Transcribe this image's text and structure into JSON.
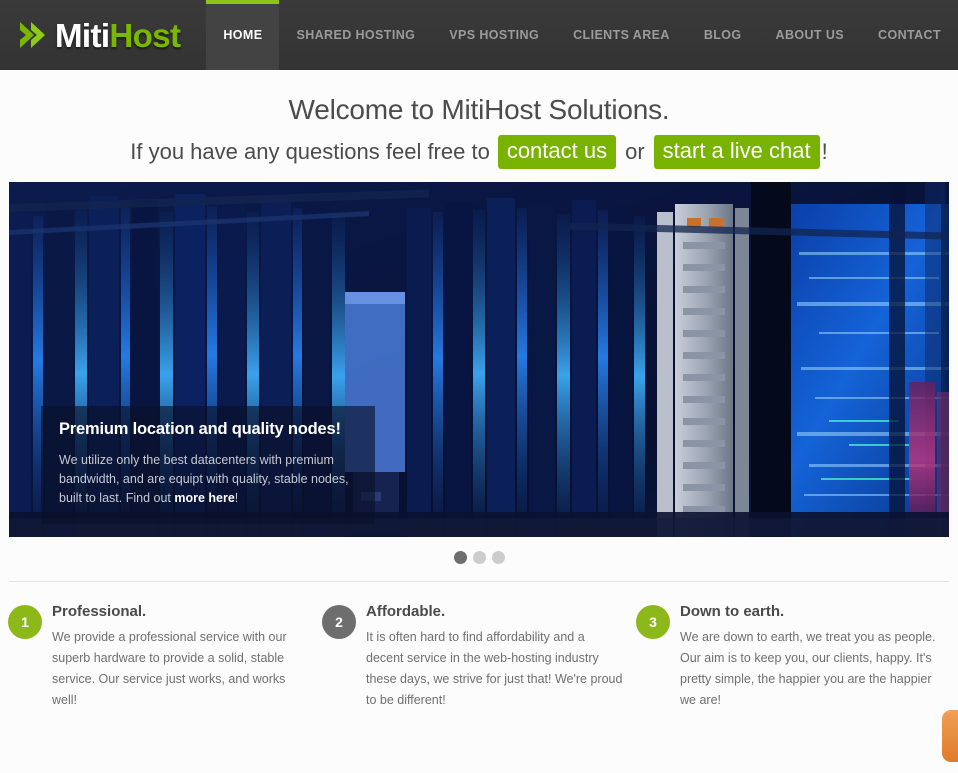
{
  "header": {
    "logo": {
      "arrow_icon": "double-chevron-right-icon",
      "text_primary": "Miti",
      "text_accent": "Host",
      "accent_color": "#7ab800"
    },
    "nav": [
      {
        "label": "HOME",
        "active": true
      },
      {
        "label": "SHARED HOSTING",
        "active": false
      },
      {
        "label": "VPS HOSTING",
        "active": false
      },
      {
        "label": "CLIENTS AREA",
        "active": false
      },
      {
        "label": "BLOG",
        "active": false
      },
      {
        "label": "ABOUT US",
        "active": false
      },
      {
        "label": "CONTACT",
        "active": false
      }
    ],
    "bg_color": "#363636",
    "active_bar_color": "#8cc417"
  },
  "welcome": {
    "title": "Welcome to MitiHost Solutions.",
    "lead_text": "If you have any questions feel free to",
    "contact_button": "contact us",
    "or_text": "or",
    "chat_button": "start a live chat",
    "trailing_text": "!",
    "button_color": "#77b300"
  },
  "slider": {
    "caption": {
      "heading": "Premium location and quality nodes!",
      "body_before": "We utilize only the best datacenters with premium bandwidth, and are equipt with quality, stable nodes, built to last. Find out ",
      "link": "more here",
      "body_after": "!"
    },
    "dots": [
      {
        "active": true
      },
      {
        "active": false
      },
      {
        "active": false
      }
    ],
    "image_description": "blue-datacenter-server-racks"
  },
  "features": [
    {
      "number": "1",
      "title": "Professional.",
      "body": "We provide a professional service with our superb hardware to provide a solid, stable service. Our service just works, and works well!",
      "color": "#8cb81a"
    },
    {
      "number": "2",
      "title": "Affordable.",
      "body": "It is often hard to find affordability and a decent service in the web-hosting industry these days, we strive for just that! We're proud to be different!",
      "color": "#6e6e6e"
    },
    {
      "number": "3",
      "title": "Down to earth.",
      "body": "We are down to earth, we treat you as people. Our aim is to keep you, our clients, happy. It's pretty simple, the happier you are the happier we are!",
      "color": "#8cb81a"
    }
  ],
  "side_tab": {
    "name": "feedback-tab",
    "color": "#e8883a"
  }
}
